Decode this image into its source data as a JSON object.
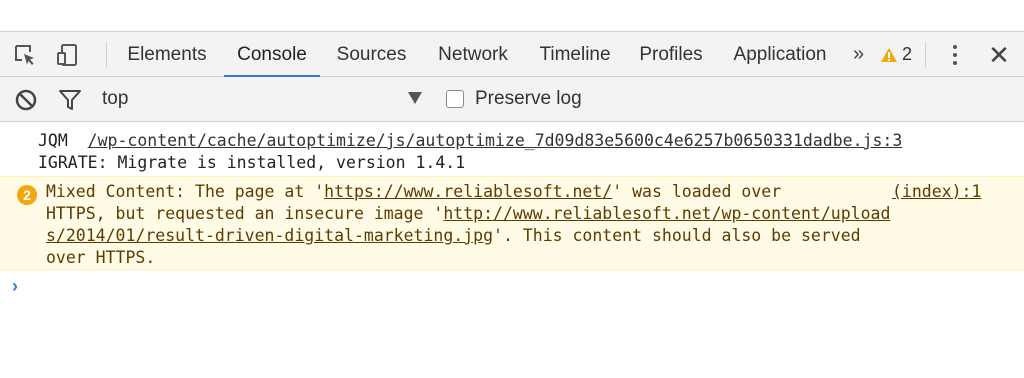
{
  "tabs": [
    {
      "label": "Elements"
    },
    {
      "label": "Console"
    },
    {
      "label": "Sources"
    },
    {
      "label": "Network"
    },
    {
      "label": "Timeline"
    },
    {
      "label": "Profiles"
    },
    {
      "label": "Application"
    }
  ],
  "active_tab": "Console",
  "overflow_label": "»",
  "warning_count": "2",
  "close_label": "✕",
  "filter": {
    "context": "top",
    "preserve_log_label": "Preserve log",
    "preserve_log_checked": false
  },
  "console": {
    "lines": [
      {
        "prefix": "JQM  ",
        "link": "/wp-content/cache/autoptimize/js/autoptimize_7d09d83e5600c4e6257b0650331dadbe.js:3"
      },
      {
        "text": "IGRATE: Migrate is installed, version 1.4.1"
      }
    ],
    "warning": {
      "count": "2",
      "source": "(index):1",
      "l1_a": "Mixed Content: The page at '",
      "l1_link": "https://www.reliablesoft.net/",
      "l1_b": "' was loaded over",
      "l2_a": "HTTPS, but requested an insecure image '",
      "l2_link": "http://www.reliablesoft.net/wp-content/upload",
      "l3_link": "s/2014/01/result-driven-digital-marketing.jpg",
      "l3_b": "'. This content should also be served",
      "l4": "over HTTPS."
    },
    "prompt": "›"
  },
  "colors": {
    "accent": "#3879d9",
    "warning_badge": "#f2a70f",
    "warning_bg": "#fffbe6",
    "warning_text": "#5c3c00"
  },
  "icons": {
    "inspect": "inspect-element-icon",
    "device": "device-toolbar-icon",
    "clear": "clear-console-icon",
    "filter": "filter-icon",
    "warning": "warning-triangle-icon",
    "menu": "kebab-menu-icon",
    "close": "close-icon"
  }
}
